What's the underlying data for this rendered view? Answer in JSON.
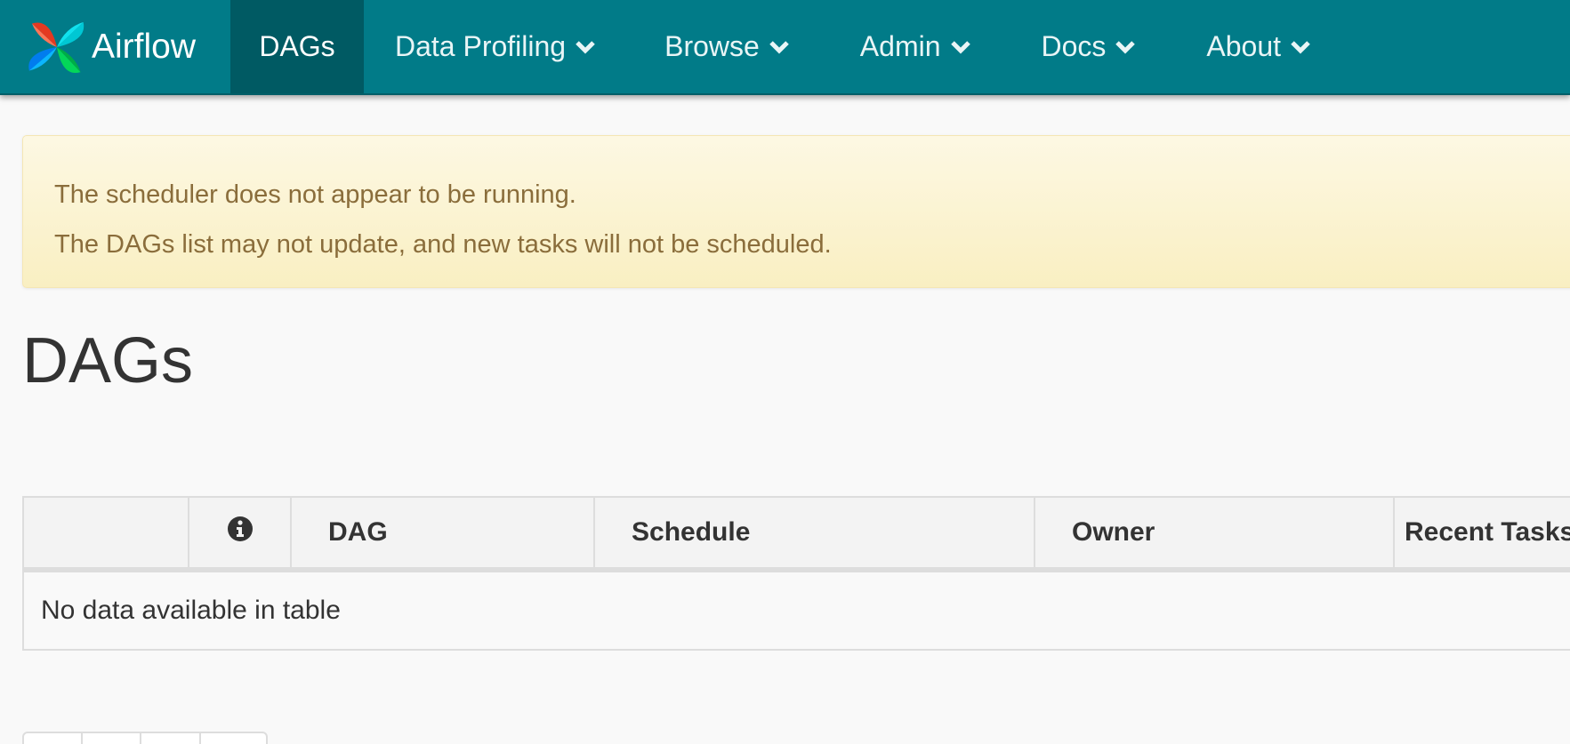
{
  "app": {
    "brand_name": "Airflow",
    "colors": {
      "navbar": "#017b88",
      "navbar_active": "#005a63",
      "alert_bg": "#fcf8e3",
      "alert_text": "#8a6d3b"
    }
  },
  "nav": {
    "items": [
      {
        "label": "DAGs",
        "active": true
      },
      {
        "label": "Data Profiling",
        "dropdown": true,
        "icon": "chevron-down-icon"
      },
      {
        "label": "Browse",
        "dropdown": true,
        "icon": "chevron-down-icon"
      },
      {
        "label": "Admin",
        "dropdown": true,
        "icon": "chevron-down-icon"
      },
      {
        "label": "Docs",
        "dropdown": true,
        "icon": "chevron-down-icon"
      },
      {
        "label": "About",
        "dropdown": true,
        "icon": "chevron-down-icon"
      }
    ]
  },
  "alert": {
    "line1": "The scheduler does not appear to be running.",
    "line2": "The DAGs list may not update, and new tasks will not be scheduled."
  },
  "page": {
    "title": "DAGs"
  },
  "table": {
    "columns": [
      "",
      "info-icon",
      "DAG",
      "Schedule",
      "Owner",
      "Recent Tasks"
    ],
    "empty_message": "No data available in table"
  }
}
